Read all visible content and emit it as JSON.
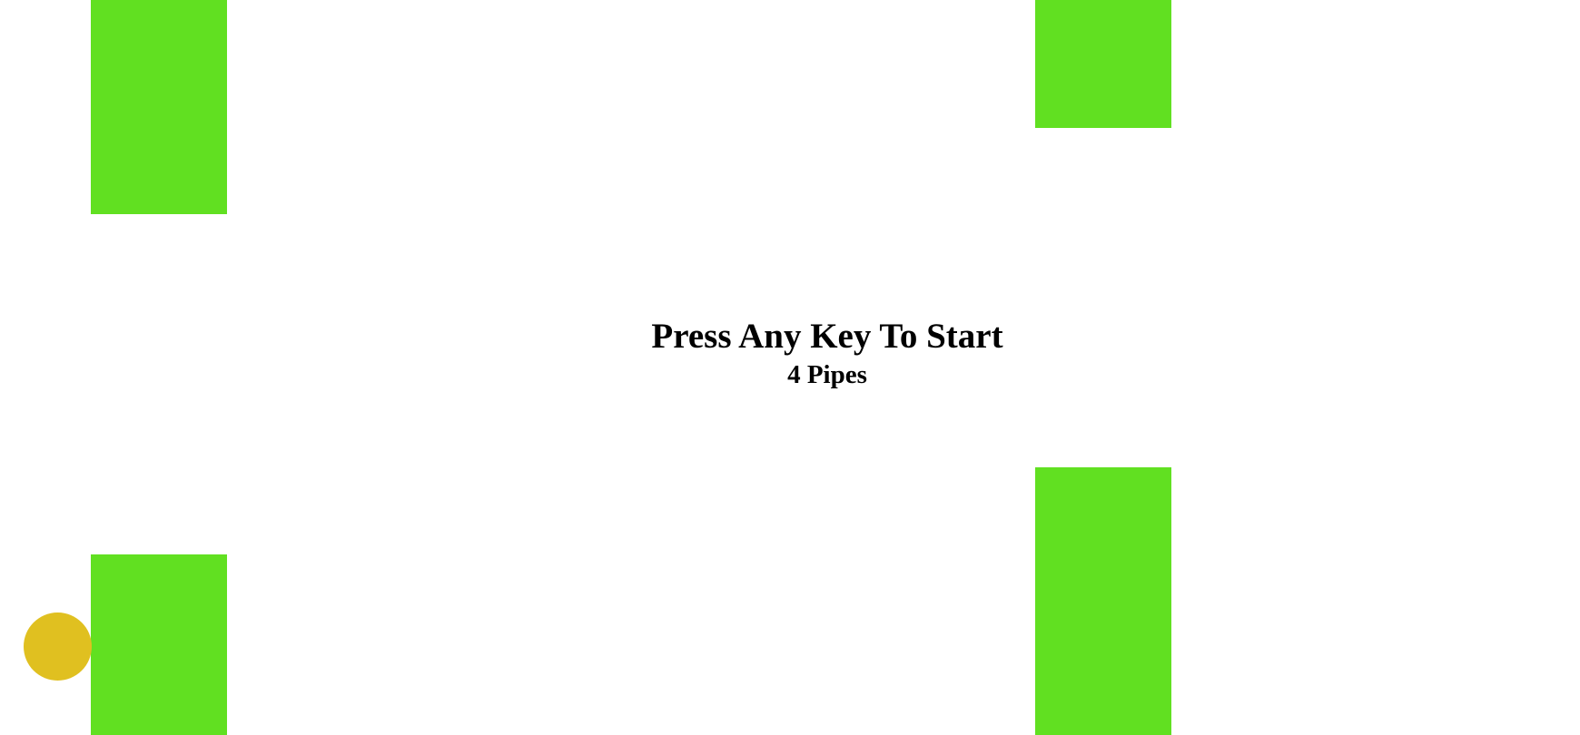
{
  "game": {
    "prompt": "Press Any Key To Start",
    "pipes_label": "4 Pipes"
  },
  "colors": {
    "background": "#ffffff",
    "pipe": "#61e021",
    "bird": "#e0c020",
    "text": "#000000"
  }
}
